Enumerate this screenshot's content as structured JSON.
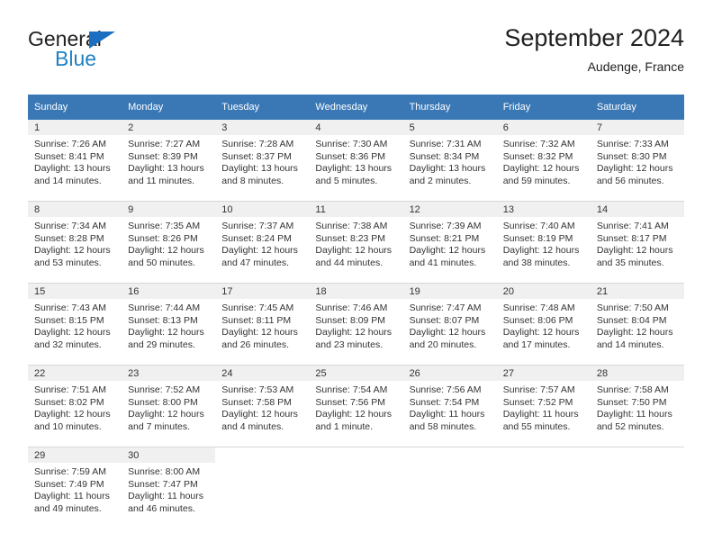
{
  "logo": {
    "word1": "General",
    "word2": "Blue",
    "triangle_color": "#1c6fc0",
    "word2_color": "#2081c3",
    "icon": "general-blue-logo"
  },
  "header": {
    "title": "September 2024",
    "subtitle": "Audenge, France"
  },
  "colors": {
    "header_row_bg": "#3a78b5",
    "daynum_bg": "#f0f0f0",
    "grid_line": "#d8d8d8",
    "text": "#333333"
  },
  "weekday_headers": [
    "Sunday",
    "Monday",
    "Tuesday",
    "Wednesday",
    "Thursday",
    "Friday",
    "Saturday"
  ],
  "labels": {
    "sunrise_prefix": "Sunrise:",
    "sunset_prefix": "Sunset:",
    "daylight_prefix": "Daylight:"
  },
  "weeks": [
    [
      {
        "day": "1",
        "sunrise": "Sunrise: 7:26 AM",
        "sunset": "Sunset: 8:41 PM",
        "daylight_line1": "Daylight: 13 hours",
        "daylight_line2": "and 14 minutes."
      },
      {
        "day": "2",
        "sunrise": "Sunrise: 7:27 AM",
        "sunset": "Sunset: 8:39 PM",
        "daylight_line1": "Daylight: 13 hours",
        "daylight_line2": "and 11 minutes."
      },
      {
        "day": "3",
        "sunrise": "Sunrise: 7:28 AM",
        "sunset": "Sunset: 8:37 PM",
        "daylight_line1": "Daylight: 13 hours",
        "daylight_line2": "and 8 minutes."
      },
      {
        "day": "4",
        "sunrise": "Sunrise: 7:30 AM",
        "sunset": "Sunset: 8:36 PM",
        "daylight_line1": "Daylight: 13 hours",
        "daylight_line2": "and 5 minutes."
      },
      {
        "day": "5",
        "sunrise": "Sunrise: 7:31 AM",
        "sunset": "Sunset: 8:34 PM",
        "daylight_line1": "Daylight: 13 hours",
        "daylight_line2": "and 2 minutes."
      },
      {
        "day": "6",
        "sunrise": "Sunrise: 7:32 AM",
        "sunset": "Sunset: 8:32 PM",
        "daylight_line1": "Daylight: 12 hours",
        "daylight_line2": "and 59 minutes."
      },
      {
        "day": "7",
        "sunrise": "Sunrise: 7:33 AM",
        "sunset": "Sunset: 8:30 PM",
        "daylight_line1": "Daylight: 12 hours",
        "daylight_line2": "and 56 minutes."
      }
    ],
    [
      {
        "day": "8",
        "sunrise": "Sunrise: 7:34 AM",
        "sunset": "Sunset: 8:28 PM",
        "daylight_line1": "Daylight: 12 hours",
        "daylight_line2": "and 53 minutes."
      },
      {
        "day": "9",
        "sunrise": "Sunrise: 7:35 AM",
        "sunset": "Sunset: 8:26 PM",
        "daylight_line1": "Daylight: 12 hours",
        "daylight_line2": "and 50 minutes."
      },
      {
        "day": "10",
        "sunrise": "Sunrise: 7:37 AM",
        "sunset": "Sunset: 8:24 PM",
        "daylight_line1": "Daylight: 12 hours",
        "daylight_line2": "and 47 minutes."
      },
      {
        "day": "11",
        "sunrise": "Sunrise: 7:38 AM",
        "sunset": "Sunset: 8:23 PM",
        "daylight_line1": "Daylight: 12 hours",
        "daylight_line2": "and 44 minutes."
      },
      {
        "day": "12",
        "sunrise": "Sunrise: 7:39 AM",
        "sunset": "Sunset: 8:21 PM",
        "daylight_line1": "Daylight: 12 hours",
        "daylight_line2": "and 41 minutes."
      },
      {
        "day": "13",
        "sunrise": "Sunrise: 7:40 AM",
        "sunset": "Sunset: 8:19 PM",
        "daylight_line1": "Daylight: 12 hours",
        "daylight_line2": "and 38 minutes."
      },
      {
        "day": "14",
        "sunrise": "Sunrise: 7:41 AM",
        "sunset": "Sunset: 8:17 PM",
        "daylight_line1": "Daylight: 12 hours",
        "daylight_line2": "and 35 minutes."
      }
    ],
    [
      {
        "day": "15",
        "sunrise": "Sunrise: 7:43 AM",
        "sunset": "Sunset: 8:15 PM",
        "daylight_line1": "Daylight: 12 hours",
        "daylight_line2": "and 32 minutes."
      },
      {
        "day": "16",
        "sunrise": "Sunrise: 7:44 AM",
        "sunset": "Sunset: 8:13 PM",
        "daylight_line1": "Daylight: 12 hours",
        "daylight_line2": "and 29 minutes."
      },
      {
        "day": "17",
        "sunrise": "Sunrise: 7:45 AM",
        "sunset": "Sunset: 8:11 PM",
        "daylight_line1": "Daylight: 12 hours",
        "daylight_line2": "and 26 minutes."
      },
      {
        "day": "18",
        "sunrise": "Sunrise: 7:46 AM",
        "sunset": "Sunset: 8:09 PM",
        "daylight_line1": "Daylight: 12 hours",
        "daylight_line2": "and 23 minutes."
      },
      {
        "day": "19",
        "sunrise": "Sunrise: 7:47 AM",
        "sunset": "Sunset: 8:07 PM",
        "daylight_line1": "Daylight: 12 hours",
        "daylight_line2": "and 20 minutes."
      },
      {
        "day": "20",
        "sunrise": "Sunrise: 7:48 AM",
        "sunset": "Sunset: 8:06 PM",
        "daylight_line1": "Daylight: 12 hours",
        "daylight_line2": "and 17 minutes."
      },
      {
        "day": "21",
        "sunrise": "Sunrise: 7:50 AM",
        "sunset": "Sunset: 8:04 PM",
        "daylight_line1": "Daylight: 12 hours",
        "daylight_line2": "and 14 minutes."
      }
    ],
    [
      {
        "day": "22",
        "sunrise": "Sunrise: 7:51 AM",
        "sunset": "Sunset: 8:02 PM",
        "daylight_line1": "Daylight: 12 hours",
        "daylight_line2": "and 10 minutes."
      },
      {
        "day": "23",
        "sunrise": "Sunrise: 7:52 AM",
        "sunset": "Sunset: 8:00 PM",
        "daylight_line1": "Daylight: 12 hours",
        "daylight_line2": "and 7 minutes."
      },
      {
        "day": "24",
        "sunrise": "Sunrise: 7:53 AM",
        "sunset": "Sunset: 7:58 PM",
        "daylight_line1": "Daylight: 12 hours",
        "daylight_line2": "and 4 minutes."
      },
      {
        "day": "25",
        "sunrise": "Sunrise: 7:54 AM",
        "sunset": "Sunset: 7:56 PM",
        "daylight_line1": "Daylight: 12 hours",
        "daylight_line2": "and 1 minute."
      },
      {
        "day": "26",
        "sunrise": "Sunrise: 7:56 AM",
        "sunset": "Sunset: 7:54 PM",
        "daylight_line1": "Daylight: 11 hours",
        "daylight_line2": "and 58 minutes."
      },
      {
        "day": "27",
        "sunrise": "Sunrise: 7:57 AM",
        "sunset": "Sunset: 7:52 PM",
        "daylight_line1": "Daylight: 11 hours",
        "daylight_line2": "and 55 minutes."
      },
      {
        "day": "28",
        "sunrise": "Sunrise: 7:58 AM",
        "sunset": "Sunset: 7:50 PM",
        "daylight_line1": "Daylight: 11 hours",
        "daylight_line2": "and 52 minutes."
      }
    ],
    [
      {
        "day": "29",
        "sunrise": "Sunrise: 7:59 AM",
        "sunset": "Sunset: 7:49 PM",
        "daylight_line1": "Daylight: 11 hours",
        "daylight_line2": "and 49 minutes."
      },
      {
        "day": "30",
        "sunrise": "Sunrise: 8:00 AM",
        "sunset": "Sunset: 7:47 PM",
        "daylight_line1": "Daylight: 11 hours",
        "daylight_line2": "and 46 minutes."
      },
      {
        "day": "",
        "sunrise": "",
        "sunset": "",
        "daylight_line1": "",
        "daylight_line2": ""
      },
      {
        "day": "",
        "sunrise": "",
        "sunset": "",
        "daylight_line1": "",
        "daylight_line2": ""
      },
      {
        "day": "",
        "sunrise": "",
        "sunset": "",
        "daylight_line1": "",
        "daylight_line2": ""
      },
      {
        "day": "",
        "sunrise": "",
        "sunset": "",
        "daylight_line1": "",
        "daylight_line2": ""
      },
      {
        "day": "",
        "sunrise": "",
        "sunset": "",
        "daylight_line1": "",
        "daylight_line2": ""
      }
    ]
  ]
}
